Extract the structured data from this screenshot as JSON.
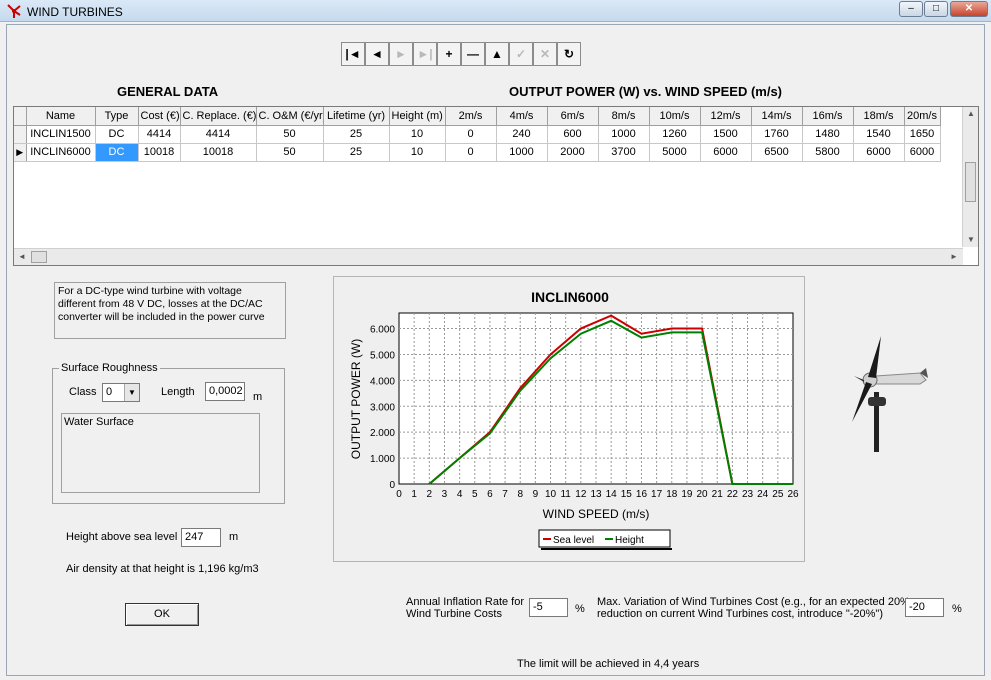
{
  "window": {
    "title": "WIND TURBINES",
    "minimize": "–",
    "maximize": "□",
    "close": "✕"
  },
  "toolbar": {
    "buttons": [
      {
        "name": "first-record-button",
        "glyph": "|◄",
        "enabled": true
      },
      {
        "name": "prior-record-button",
        "glyph": "◄",
        "enabled": true
      },
      {
        "name": "next-record-button",
        "glyph": "►",
        "enabled": false
      },
      {
        "name": "last-record-button",
        "glyph": "►|",
        "enabled": false
      },
      {
        "name": "insert-record-button",
        "glyph": "+",
        "enabled": true
      },
      {
        "name": "delete-record-button",
        "glyph": "—",
        "enabled": true
      },
      {
        "name": "edit-record-button",
        "glyph": "▲",
        "enabled": true
      },
      {
        "name": "post-edit-button",
        "glyph": "✓",
        "enabled": false
      },
      {
        "name": "cancel-edit-button",
        "glyph": "✕",
        "enabled": false
      },
      {
        "name": "refresh-button",
        "glyph": "↻",
        "enabled": true
      }
    ]
  },
  "general_data_heading": "GENERAL DATA",
  "output_power_heading": "OUTPUT POWER (W)  vs. WIND SPEED (m/s)",
  "grid": {
    "columns": [
      "Name",
      "Type",
      "Cost (€)",
      "C. Replace. (€)",
      "C. O&M (€/yr)",
      "Lifetime (yr)",
      "Height (m)",
      "2m/s",
      "4m/s",
      "6m/s",
      "8m/s",
      "10m/s",
      "12m/s",
      "14m/s",
      "16m/s",
      "18m/s",
      "20m/s"
    ],
    "rows": [
      [
        "INCLIN1500",
        "DC",
        "4414",
        "4414",
        "50",
        "25",
        "10",
        "0",
        "240",
        "600",
        "1000",
        "1260",
        "1500",
        "1760",
        "1480",
        "1540",
        "1650"
      ],
      [
        "INCLIN6000",
        "DC",
        "10018",
        "10018",
        "50",
        "25",
        "10",
        "0",
        "1000",
        "2000",
        "3700",
        "5000",
        "6000",
        "6500",
        "5800",
        "6000",
        "6000"
      ]
    ],
    "current_row": 1,
    "selected_cell": "Type"
  },
  "dc_note": "For a DC-type wind turbine with voltage different from 48 V DC, losses at the DC/AC converter will be included in the power curve",
  "roughness": {
    "legend": "Surface Roughness",
    "class_label": "Class",
    "class_value": "0",
    "length_label": "Length",
    "length_value": "0,0002",
    "length_unit": "m",
    "description": "Water Surface"
  },
  "height": {
    "label": "Height above sea level",
    "value": "247",
    "unit": "m"
  },
  "air_density_text": "Air density at that height is 1,196 kg/m3",
  "ok_label": "OK",
  "inflation": {
    "label_line1": "Annual Inflation Rate for",
    "label_line2": "Wind Turbine Costs",
    "value": "-5",
    "unit": "%"
  },
  "max_variation": {
    "label_line1": "Max. Variation of Wind Turbines Cost (e.g., for an expected 20%",
    "label_line2": "reduction on current Wind Turbines cost, introduce \"-20%\")",
    "value": "-20",
    "unit": "%"
  },
  "limit_text": "The limit will be achieved in 4,4 years",
  "colors": {
    "sea_level": "#cc0000",
    "height": "#008000",
    "selection": "#3399ff"
  },
  "chart_data": {
    "type": "line",
    "title": "INCLIN6000",
    "xlabel": "WIND SPEED (m/s)",
    "ylabel": "OUTPUT POWER (W)",
    "x": [
      0,
      1,
      2,
      3,
      4,
      5,
      6,
      7,
      8,
      9,
      10,
      11,
      12,
      13,
      14,
      15,
      16,
      17,
      18,
      19,
      20,
      21,
      22,
      23,
      24,
      25,
      26
    ],
    "xlim": [
      0,
      26
    ],
    "ylim": [
      0,
      6600
    ],
    "yticks": [
      0,
      1000,
      2000,
      3000,
      4000,
      5000,
      6000
    ],
    "ytick_labels": [
      "0",
      "1.000",
      "2.000",
      "3.000",
      "4.000",
      "5.000",
      "6.000"
    ],
    "grid": true,
    "legend_position": "bottom-center",
    "series": [
      {
        "name": "Sea level",
        "color": "#cc0000",
        "points": [
          [
            2,
            0
          ],
          [
            4,
            1000
          ],
          [
            6,
            2000
          ],
          [
            8,
            3700
          ],
          [
            10,
            5000
          ],
          [
            12,
            6000
          ],
          [
            14,
            6500
          ],
          [
            16,
            5800
          ],
          [
            18,
            6000
          ],
          [
            20,
            6000
          ],
          [
            22,
            0
          ],
          [
            26,
            0
          ]
        ]
      },
      {
        "name": "Height",
        "color": "#008000",
        "points": [
          [
            2,
            0
          ],
          [
            4,
            1000
          ],
          [
            6,
            1950
          ],
          [
            8,
            3600
          ],
          [
            10,
            4850
          ],
          [
            12,
            5800
          ],
          [
            14,
            6300
          ],
          [
            16,
            5650
          ],
          [
            18,
            5850
          ],
          [
            20,
            5850
          ],
          [
            22,
            0
          ],
          [
            26,
            0
          ]
        ]
      }
    ]
  }
}
